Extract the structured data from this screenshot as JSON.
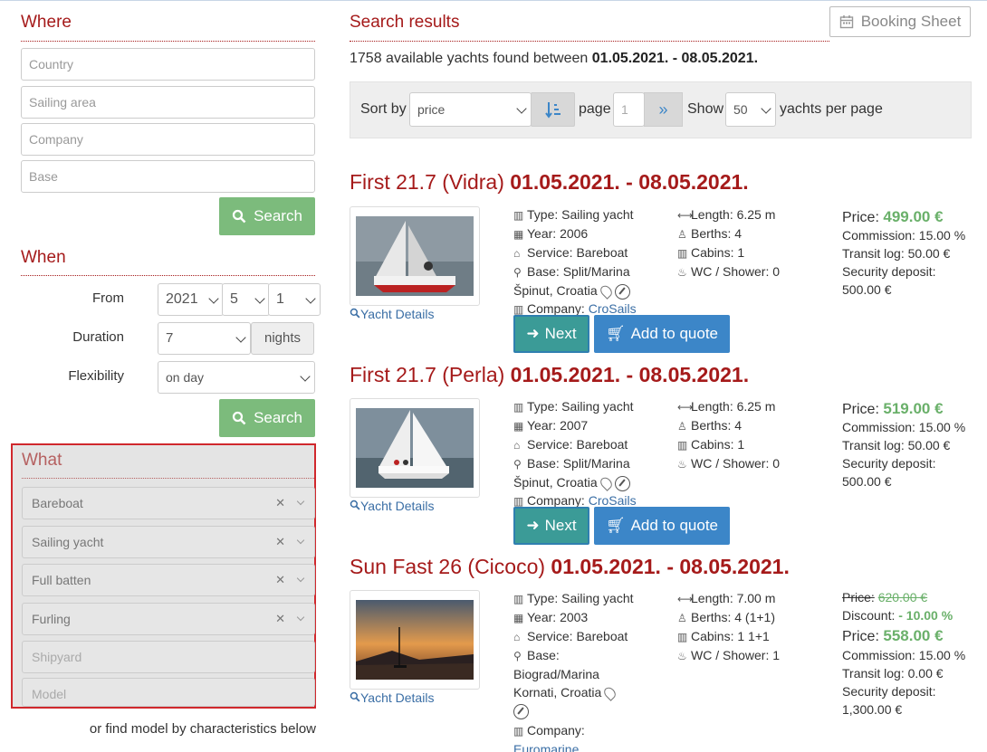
{
  "where": {
    "title": "Where",
    "country_placeholder": "Country",
    "area_placeholder": "Sailing area",
    "company_placeholder": "Company",
    "base_placeholder": "Base",
    "search_label": "Search"
  },
  "when": {
    "title": "When",
    "from_label": "From",
    "year": "2021",
    "month": "5",
    "day": "1",
    "duration_label": "Duration",
    "duration": "7",
    "nights_label": "nights",
    "flex_label": "Flexibility",
    "flex": "on day",
    "search_label": "Search"
  },
  "what": {
    "title": "What",
    "chips": [
      "Bareboat",
      "Sailing yacht",
      "Full batten",
      "Furling"
    ],
    "shipyard_placeholder": "Shipyard",
    "model_placeholder": "Model",
    "find_model_text": "or find model by characteristics below"
  },
  "results": {
    "title": "Search results",
    "booking_label": "Booking Sheet",
    "summary_prefix": "1758 available yachts found between",
    "summary_dates": "01.05.2021. - 08.05.2021.",
    "sort_label": "Sort by",
    "sort_value": "price",
    "page_label": "page",
    "page_value": "1",
    "show_label": "Show",
    "show_value": "50",
    "per_page_label": "yachts per page"
  },
  "yachts": [
    {
      "name": "First 21.7 (Vidra)",
      "dates": "01.05.2021. - 08.05.2021.",
      "type": "Type: Sailing yacht",
      "year": "Year: 2006",
      "service": "Service: Bareboat",
      "base": "Base: Split/Marina",
      "location": "Špinut,  Croatia",
      "company_label": "Company:",
      "company": "CroSails",
      "length": "Length: 6.25 m",
      "berths": "Berths: 4",
      "cabins": "Cabins: 1",
      "wc": "WC / Shower: 0",
      "price_label": "Price:",
      "price": "499.00 €",
      "commission": "Commission: 15.00 %",
      "transit": "Transit log: 50.00 €",
      "deposit_label": "Security deposit:",
      "deposit": "500.00 €",
      "details_label": "Yacht Details",
      "next_label": "Next",
      "quote_label": "Add to quote"
    },
    {
      "name": "First 21.7 (Perla)",
      "dates": "01.05.2021. - 08.05.2021.",
      "type": "Type: Sailing yacht",
      "year": "Year: 2007",
      "service": "Service: Bareboat",
      "base": "Base: Split/Marina",
      "location": "Špinut,  Croatia",
      "company_label": "Company:",
      "company": "CroSails",
      "length": "Length: 6.25 m",
      "berths": "Berths: 4",
      "cabins": "Cabins: 1",
      "wc": "WC / Shower: 0",
      "price_label": "Price:",
      "price": "519.00 €",
      "commission": "Commission: 15.00 %",
      "transit": "Transit log: 50.00 €",
      "deposit_label": "Security deposit:",
      "deposit": "500.00 €",
      "details_label": "Yacht Details",
      "next_label": "Next",
      "quote_label": "Add to quote"
    },
    {
      "name": "Sun Fast 26 (Cicoco)",
      "dates": "01.05.2021. - 08.05.2021.",
      "type": "Type: Sailing yacht",
      "year": "Year: 2003",
      "service": "Service: Bareboat",
      "base": "Base:",
      "base2": "Biograd/Marina",
      "location": "Kornati,  Croatia",
      "company_label": "Company:",
      "company": "Euromarine",
      "length": "Length: 7.00 m",
      "berths": "Berths: 4 (1+1)",
      "cabins": "Cabins: 1 1+1",
      "wc": "WC / Shower: 1",
      "old_price_label": "Price:",
      "old_price": "620.00 €",
      "discount_label": "Discount:",
      "discount": "- 10.00 %",
      "price_label": "Price:",
      "price": "558.00 €",
      "commission": "Commission: 15.00 %",
      "transit": "Transit log: 0.00 €",
      "deposit_label": "Security deposit:",
      "deposit": "1,300.00 €",
      "details_label": "Yacht Details"
    }
  ],
  "colors": {
    "accent_red": "#a51a1a",
    "green": "#7cbb7c",
    "price_green": "#6ab06a",
    "link_blue": "#3a6ea5",
    "quote_blue": "#3c86c8",
    "next_teal": "#3b9b97",
    "highlight_border": "#d0282d"
  }
}
